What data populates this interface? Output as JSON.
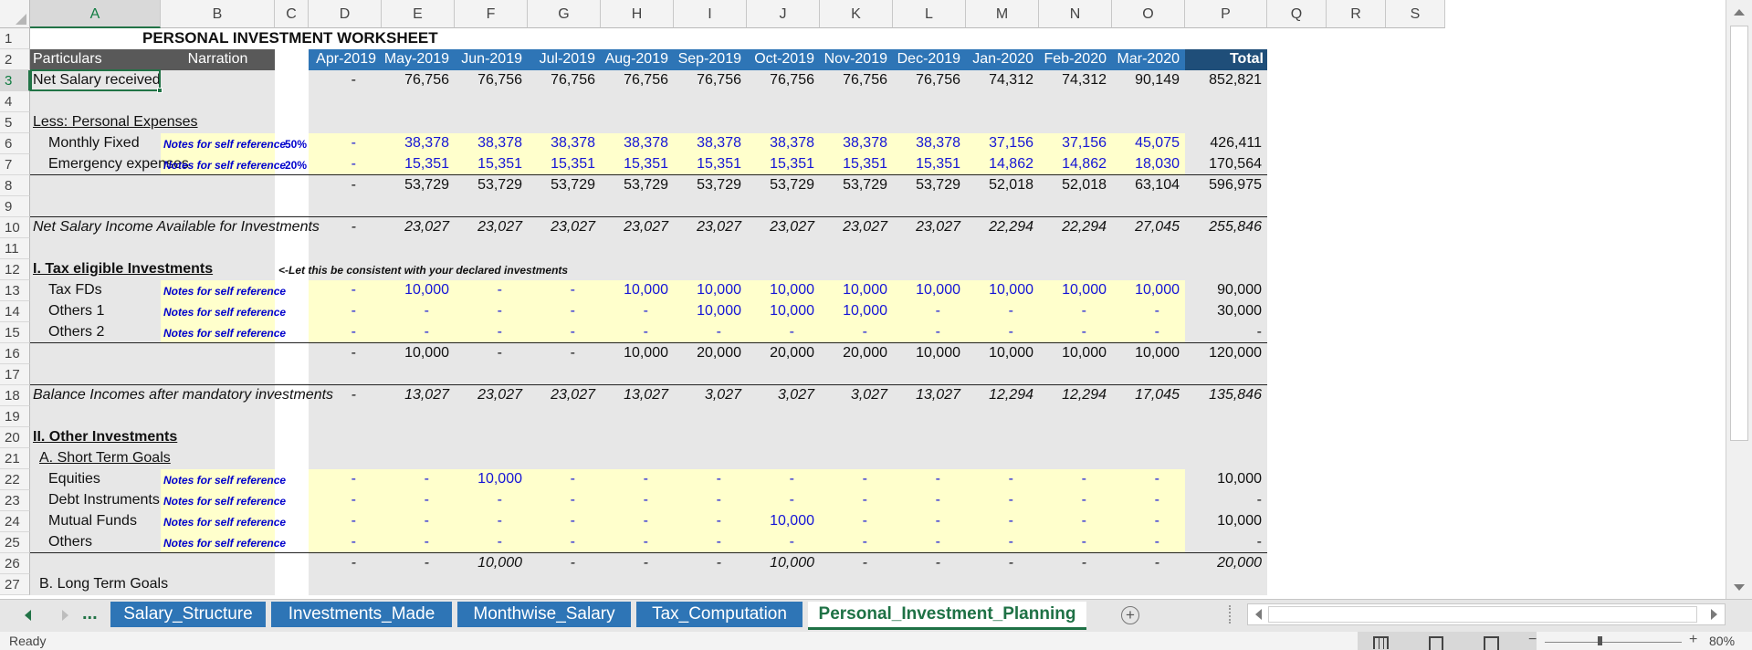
{
  "columns": [
    "A",
    "B",
    "C",
    "D",
    "E",
    "F",
    "G",
    "H",
    "I",
    "J",
    "K",
    "L",
    "M",
    "N",
    "O",
    "P",
    "Q",
    "R",
    "S"
  ],
  "selected_column": "A",
  "row_numbers": [
    "1",
    "2",
    "3",
    "4",
    "5",
    "6",
    "7",
    "8",
    "9",
    "10",
    "11",
    "12",
    "13",
    "14",
    "15",
    "16",
    "17",
    "18",
    "19",
    "20",
    "21",
    "22",
    "23",
    "24",
    "25",
    "26",
    "27"
  ],
  "selected_row": "3",
  "sheet": {
    "title": "PERSONAL INVESTMENT WORKSHEET",
    "header": {
      "particulars": "Particulars",
      "narration": "Narration",
      "months": [
        "Apr-2019",
        "May-2019",
        "Jun-2019",
        "Jul-2019",
        "Aug-2019",
        "Sep-2019",
        "Oct-2019",
        "Nov-2019",
        "Dec-2019",
        "Jan-2020",
        "Feb-2020",
        "Mar-2020"
      ],
      "total": "Total"
    },
    "rows": [
      {
        "row": 3,
        "label": "Net Salary received",
        "values": [
          "-",
          "76,756",
          "76,756",
          "76,756",
          "76,756",
          "76,756",
          "76,756",
          "76,756",
          "76,756",
          "74,312",
          "74,312",
          "90,149"
        ],
        "total": "852,821"
      },
      {
        "row": 5,
        "label": "Less: Personal Expenses"
      },
      {
        "row": 6,
        "label": "Monthly Fixed",
        "note": "Notes for self reference",
        "pct": "50%",
        "values": [
          "-",
          "38,378",
          "38,378",
          "38,378",
          "38,378",
          "38,378",
          "38,378",
          "38,378",
          "38,378",
          "37,156",
          "37,156",
          "45,075"
        ],
        "total": "426,411"
      },
      {
        "row": 7,
        "label": "Emergency expenses",
        "note": "Notes for self reference",
        "pct": "20%",
        "values": [
          "-",
          "15,351",
          "15,351",
          "15,351",
          "15,351",
          "15,351",
          "15,351",
          "15,351",
          "15,351",
          "14,862",
          "14,862",
          "18,030"
        ],
        "total": "170,564"
      },
      {
        "row": 8,
        "values": [
          "-",
          "53,729",
          "53,729",
          "53,729",
          "53,729",
          "53,729",
          "53,729",
          "53,729",
          "53,729",
          "52,018",
          "52,018",
          "63,104"
        ],
        "total": "596,975"
      },
      {
        "row": 10,
        "label": "Net Salary Income Available for Investments",
        "values": [
          "-",
          "23,027",
          "23,027",
          "23,027",
          "23,027",
          "23,027",
          "23,027",
          "23,027",
          "23,027",
          "22,294",
          "22,294",
          "27,045"
        ],
        "total": "255,846"
      },
      {
        "row": 12,
        "label": "I. Tax eligible Investments",
        "annotation": "<-Let this be consistent with your declared investments"
      },
      {
        "row": 13,
        "label": "Tax FDs",
        "note": "Notes for self reference",
        "values": [
          "-",
          "10,000",
          "-",
          "-",
          "10,000",
          "10,000",
          "10,000",
          "10,000",
          "10,000",
          "10,000",
          "10,000",
          "10,000"
        ],
        "total": "90,000"
      },
      {
        "row": 14,
        "label": "Others 1",
        "note": "Notes for self reference",
        "values": [
          "-",
          "-",
          "-",
          "-",
          "-",
          "10,000",
          "10,000",
          "10,000",
          "-",
          "-",
          "-",
          "-"
        ],
        "total": "30,000"
      },
      {
        "row": 15,
        "label": "Others 2",
        "note": "Notes for self reference",
        "values": [
          "-",
          "-",
          "-",
          "-",
          "-",
          "-",
          "-",
          "-",
          "-",
          "-",
          "-",
          "-"
        ],
        "total": "-"
      },
      {
        "row": 16,
        "values": [
          "-",
          "10,000",
          "-",
          "-",
          "10,000",
          "20,000",
          "20,000",
          "20,000",
          "10,000",
          "10,000",
          "10,000",
          "10,000"
        ],
        "total": "120,000"
      },
      {
        "row": 18,
        "label": "Balance Incomes after mandatory investments",
        "values": [
          "-",
          "13,027",
          "23,027",
          "23,027",
          "13,027",
          "3,027",
          "3,027",
          "3,027",
          "13,027",
          "12,294",
          "12,294",
          "17,045"
        ],
        "total": "135,846"
      },
      {
        "row": 20,
        "label": "II. Other Investments"
      },
      {
        "row": 21,
        "label": "A. Short Term Goals"
      },
      {
        "row": 22,
        "label": "Equities",
        "note": "Notes for self reference",
        "values": [
          "-",
          "-",
          "10,000",
          "-",
          "-",
          "-",
          "-",
          "-",
          "-",
          "-",
          "-",
          "-"
        ],
        "total": "10,000"
      },
      {
        "row": 23,
        "label": "Debt Instruments",
        "note": "Notes for self reference",
        "values": [
          "-",
          "-",
          "-",
          "-",
          "-",
          "-",
          "-",
          "-",
          "-",
          "-",
          "-",
          "-"
        ],
        "total": "-"
      },
      {
        "row": 24,
        "label": "Mutual Funds",
        "note": "Notes for self reference",
        "values": [
          "-",
          "-",
          "-",
          "-",
          "-",
          "-",
          "10,000",
          "-",
          "-",
          "-",
          "-",
          "-"
        ],
        "total": "10,000"
      },
      {
        "row": 25,
        "label": "Others",
        "note": "Notes for self reference",
        "values": [
          "-",
          "-",
          "-",
          "-",
          "-",
          "-",
          "-",
          "-",
          "-",
          "-",
          "-",
          "-"
        ],
        "total": "-"
      },
      {
        "row": 26,
        "values": [
          "-",
          "-",
          "10,000",
          "-",
          "-",
          "-",
          "10,000",
          "-",
          "-",
          "-",
          "-",
          "-"
        ],
        "total": "20,000"
      },
      {
        "row": 27,
        "label": "B. Long Term Goals"
      }
    ]
  },
  "tabs": {
    "nav_ellipsis": "...",
    "items": [
      "Salary_Structure",
      "Investments_Made",
      "Monthwise_Salary",
      "Tax_Computation",
      "Personal_Investment_Planning"
    ],
    "active_index": 4,
    "add_label": "+"
  },
  "status": {
    "ready": "Ready",
    "zoom": "80%"
  },
  "colors": {
    "header_blue": "#2e75b6",
    "total_dark": "#1f4e79",
    "gray_label": "#595959",
    "input_yellow": "#ffffcc",
    "excel_green": "#217346"
  }
}
